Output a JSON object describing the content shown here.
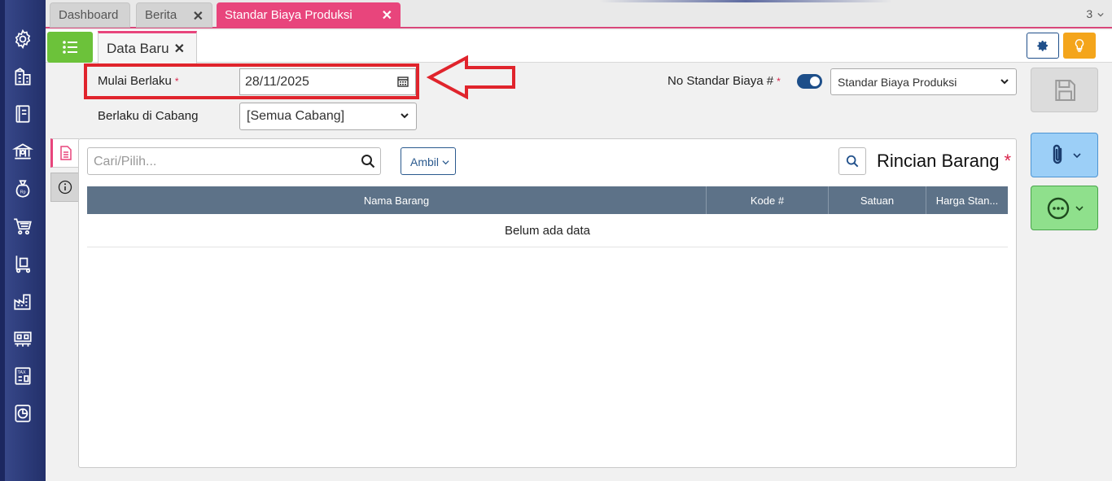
{
  "tabs": [
    {
      "label": "Dashboard"
    },
    {
      "label": "Berita"
    },
    {
      "label": "Standar Biaya Produksi"
    }
  ],
  "tab_count": "3",
  "subtab": {
    "label": "Data Baru"
  },
  "form": {
    "mulai_berlaku_label": "Mulai Berlaku",
    "mulai_berlaku_value": "28/11/2025",
    "cabang_label": "Berlaku di Cabang",
    "cabang_value": "[Semua Cabang]",
    "no_standar_label": "No Standar Biaya #",
    "no_standar_value": "Standar Biaya Produksi",
    "required_mark": "*"
  },
  "detail": {
    "search_placeholder": "Cari/Pilih...",
    "ambil_label": "Ambil",
    "title": "Rincian Barang",
    "columns": [
      "Nama Barang",
      "Kode #",
      "Satuan",
      "Harga Stan..."
    ],
    "empty_text": "Belum ada data"
  },
  "colors": {
    "accent_pink": "#e8457c",
    "sidebar_blue": "#2b3a78",
    "table_header": "#5d7288",
    "highlight_red": "#e0242c"
  },
  "sidebar_icons": [
    "gear-icon",
    "building-icon",
    "book-icon",
    "bank-icon",
    "money-bag-icon",
    "cart-icon",
    "handcart-icon",
    "factory-icon",
    "production-icon",
    "tax-icon",
    "report-icon"
  ]
}
